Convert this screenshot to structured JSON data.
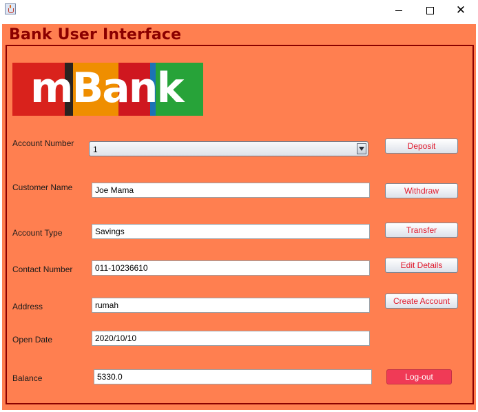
{
  "window": {
    "title": "",
    "minimize_glyph": "",
    "maximize_glyph": "",
    "close_glyph": "✕"
  },
  "app": {
    "heading": "Bank User Interface"
  },
  "logo": {
    "text": "mBank",
    "colors": [
      "#d9221c",
      "#2a2320",
      "#ef8e00",
      "#cf171f",
      "#1c73b6",
      "#27a339"
    ]
  },
  "form": {
    "account_number": {
      "label": "Account Number",
      "value": "1"
    },
    "customer_name": {
      "label": "Customer Name",
      "value": "Joe Mama"
    },
    "account_type": {
      "label": "Account Type",
      "value": "Savings"
    },
    "contact_number": {
      "label": "Contact Number",
      "value": "011-10236610"
    },
    "address": {
      "label": "Address",
      "value": "rumah"
    },
    "open_date": {
      "label": "Open Date",
      "value": "2020/10/10"
    },
    "balance": {
      "label": "Balance",
      "value": "5330.0"
    }
  },
  "buttons": {
    "deposit": "Deposit",
    "withdraw": "Withdraw",
    "transfer": "Transfer",
    "edit_details": "Edit Details",
    "create_account": "Create Account",
    "logout": "Log-out"
  },
  "colors": {
    "background": "#ff7f50",
    "heading": "#8b0000",
    "button_text": "#e0192c",
    "logout_bg": "#f03a56"
  }
}
